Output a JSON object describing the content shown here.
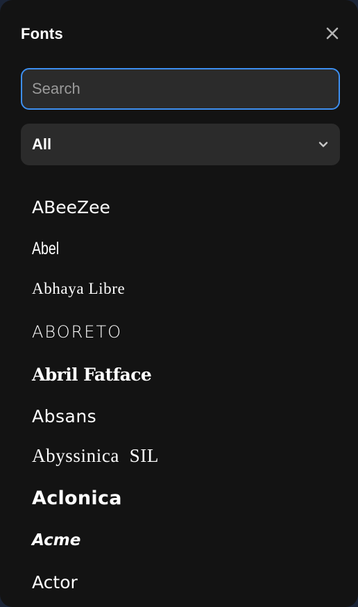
{
  "panel": {
    "title": "Fonts"
  },
  "search": {
    "placeholder": "Search",
    "value": ""
  },
  "filter": {
    "selected": "All"
  },
  "fonts": [
    {
      "name": "ABeeZee"
    },
    {
      "name": "Abel"
    },
    {
      "name": "Abhaya Libre"
    },
    {
      "name": "ABORETO"
    },
    {
      "name": "Abril Fatface"
    },
    {
      "name": "Absans"
    },
    {
      "name": "Abyssinica  SIL"
    },
    {
      "name": "Aclonica"
    },
    {
      "name": "Acme"
    },
    {
      "name": "Actor"
    }
  ],
  "icons": {
    "close": "close-icon",
    "dropdown": "chevron-down-icon"
  },
  "colors": {
    "panel_background": "#131313",
    "field_background": "#2b2b2b",
    "focus_border": "#3d8ff0",
    "text": "#ffffff",
    "placeholder": "#9a9a9a"
  }
}
